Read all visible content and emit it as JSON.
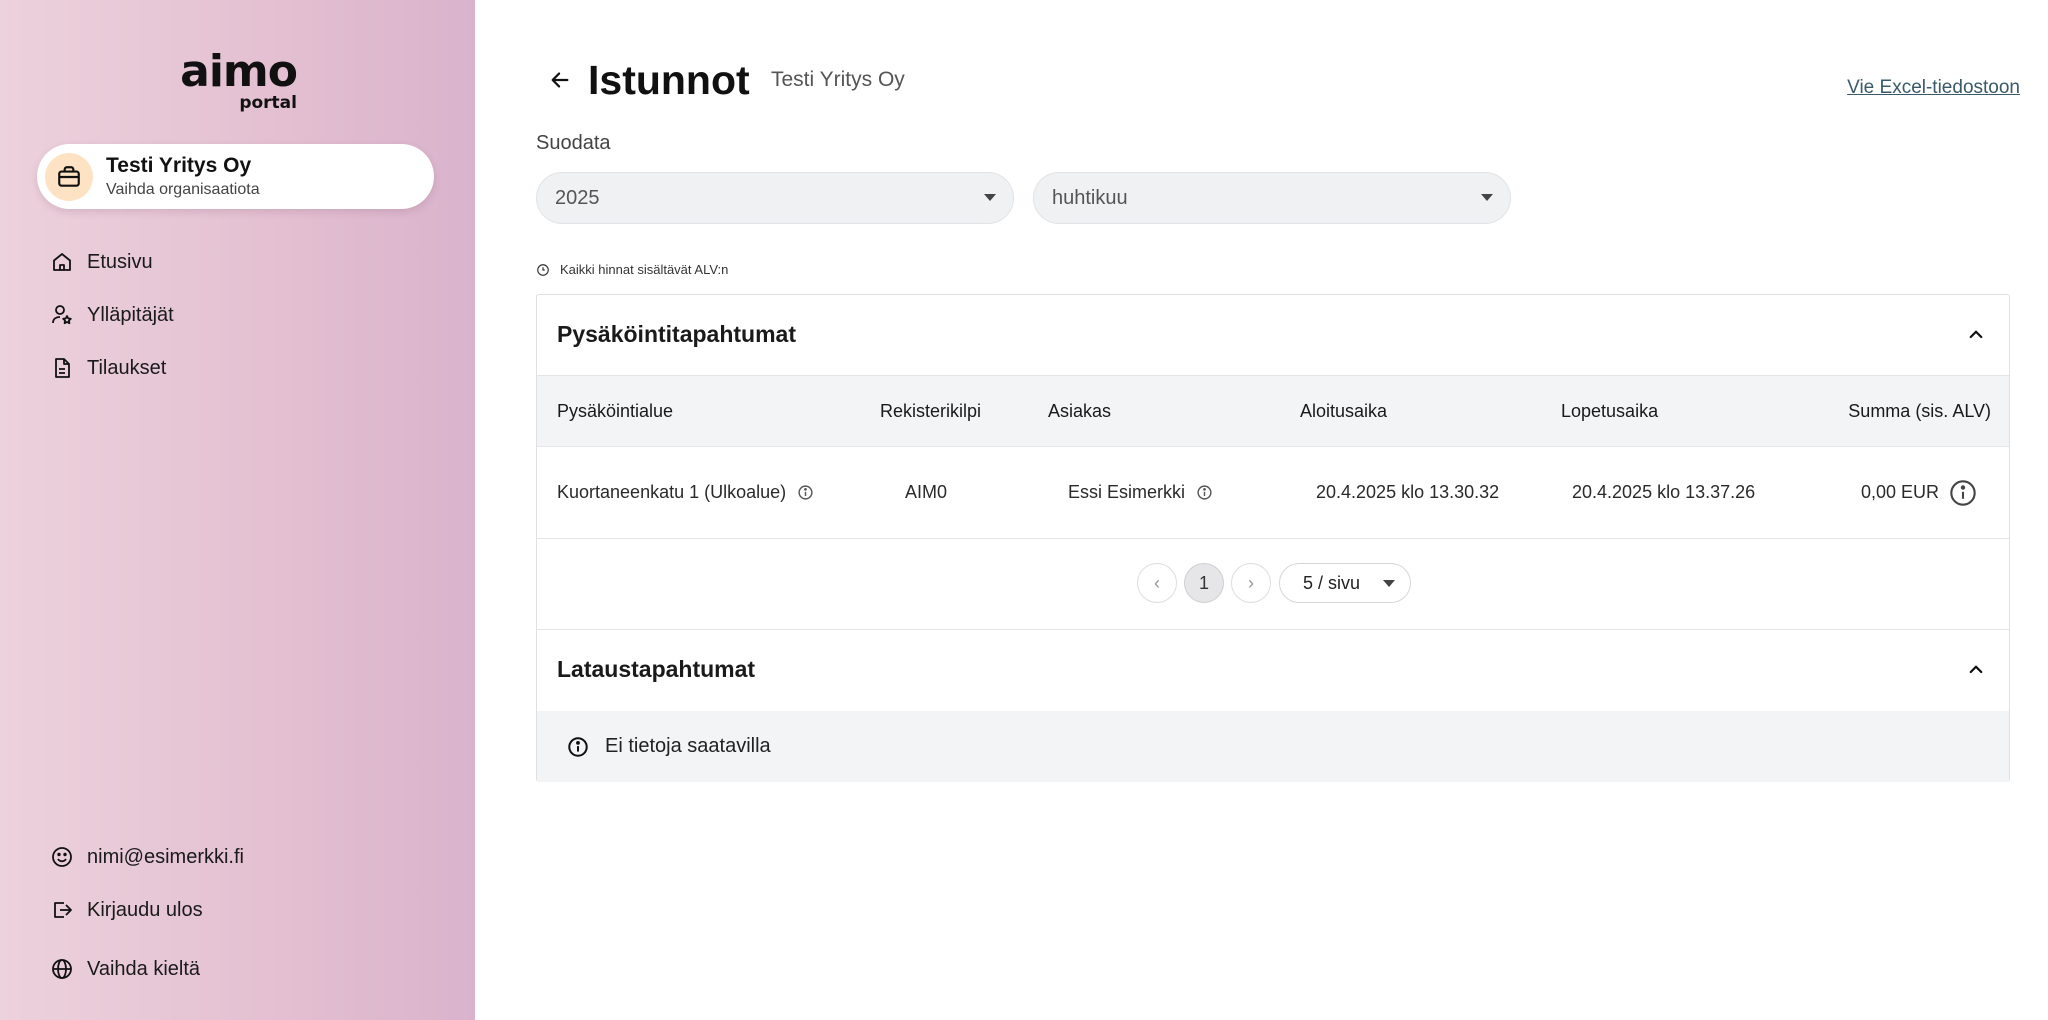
{
  "brand": {
    "name": "aimo",
    "sub": "portal"
  },
  "organization": {
    "name": "Testi Yritys Oy",
    "switch_label": "Vaihda organisaatiota"
  },
  "nav": {
    "items": [
      {
        "label": "Etusivu",
        "icon": "home-icon"
      },
      {
        "label": "Ylläpitäjät",
        "icon": "admin-user-icon"
      },
      {
        "label": "Tilaukset",
        "icon": "document-icon"
      }
    ],
    "bottom": [
      {
        "label": "nimi@esimerkki.fi",
        "icon": "smiley-icon"
      },
      {
        "label": "Kirjaudu ulos",
        "icon": "logout-icon"
      },
      {
        "label": "Vaihda kieltä",
        "icon": "globe-icon"
      }
    ]
  },
  "header": {
    "title": "Istunnot",
    "subtitle": "Testi Yritys Oy",
    "export_link": "Vie Excel-tiedostoon"
  },
  "filter": {
    "label": "Suodata",
    "year": "2025",
    "month": "huhtikuu"
  },
  "vat_note": "Kaikki hinnat sisältävät ALV:n",
  "parking": {
    "title": "Pysäköintitapahtumat",
    "columns": [
      "Pysäköintialue",
      "Rekisterikilpi",
      "Asiakas",
      "Aloitusaika",
      "Lopetusaika",
      "Summa (sis. ALV)"
    ],
    "rows": [
      {
        "area": "Kuortaneenkatu 1 (Ulkoalue)",
        "plate": "AIM0",
        "customer": "Essi Esimerkki",
        "start": "20.4.2025 klo 13.30.32",
        "end": "20.4.2025 klo 13.37.26",
        "sum": "0,00 EUR"
      }
    ],
    "pagination": {
      "prev": "‹",
      "current": "1",
      "next": "›",
      "per_page": "5 / sivu"
    }
  },
  "charging": {
    "title": "Lataustapahtumat",
    "empty_text": "Ei tietoja saatavilla"
  },
  "colors": {
    "sidebar_gradient_start": "#ecd2dc",
    "sidebar_gradient_end": "#d9b3cc",
    "org_icon_bg": "#fde3c3",
    "link": "#3a5a6a"
  }
}
